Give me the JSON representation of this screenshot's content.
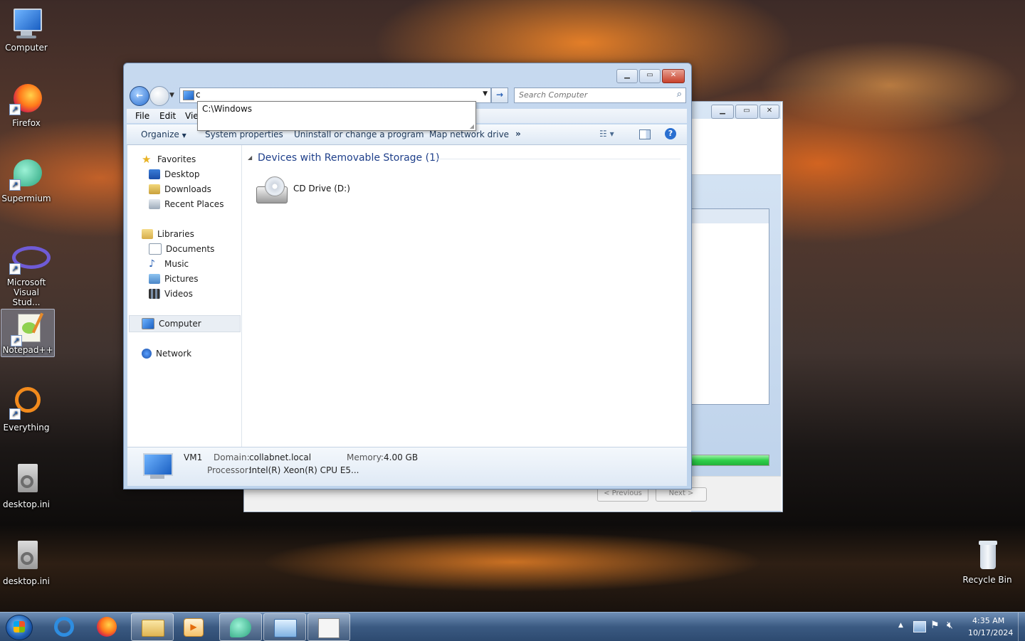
{
  "desktop": {
    "icons": [
      {
        "label": "Computer"
      },
      {
        "label": "Firefox"
      },
      {
        "label": "Supermium"
      },
      {
        "label": "Microsoft Visual Stud..."
      },
      {
        "label": "Notepad++"
      },
      {
        "label": "Everything"
      },
      {
        "label": "desktop.ini"
      },
      {
        "label": "desktop.ini"
      },
      {
        "label": "Recycle Bin"
      }
    ]
  },
  "back_window": {
    "previous_label": "< Previous",
    "next_label": "Next >",
    "progress": 1.0
  },
  "explorer": {
    "address_value": "c",
    "autocomplete_suggestion": "C:\\Windows",
    "search_placeholder": "Search Computer",
    "menu": {
      "file": "File",
      "edit": "Edit",
      "view": "Vie"
    },
    "toolbar": {
      "organize": "Organize",
      "system_properties": "System properties",
      "uninstall": "Uninstall or change a program",
      "map_drive": "Map network drive",
      "more": "»"
    },
    "nav": {
      "favorites": "Favorites",
      "desktop": "Desktop",
      "downloads": "Downloads",
      "recent_places": "Recent Places",
      "libraries": "Libraries",
      "documents": "Documents",
      "music": "Music",
      "pictures": "Pictures",
      "videos": "Videos",
      "computer": "Computer",
      "network": "Network"
    },
    "group_header": "Devices with Removable Storage (1)",
    "drive_label": "CD Drive (D:)",
    "details": {
      "name": "VM1",
      "domain_label": "Domain:",
      "domain_value": "collabnet.local",
      "memory_label": "Memory:",
      "memory_value": "4.00 GB",
      "processor_label": "Processor:",
      "processor_value": "Intel(R) Xeon(R) CPU E5..."
    }
  },
  "taskbar": {
    "time": "4:35 AM",
    "date": "10/17/2024"
  },
  "colors": {
    "accent": "#1e5bb0",
    "progress_green": "#2fd04a",
    "taskbar": "#3b5a82"
  }
}
